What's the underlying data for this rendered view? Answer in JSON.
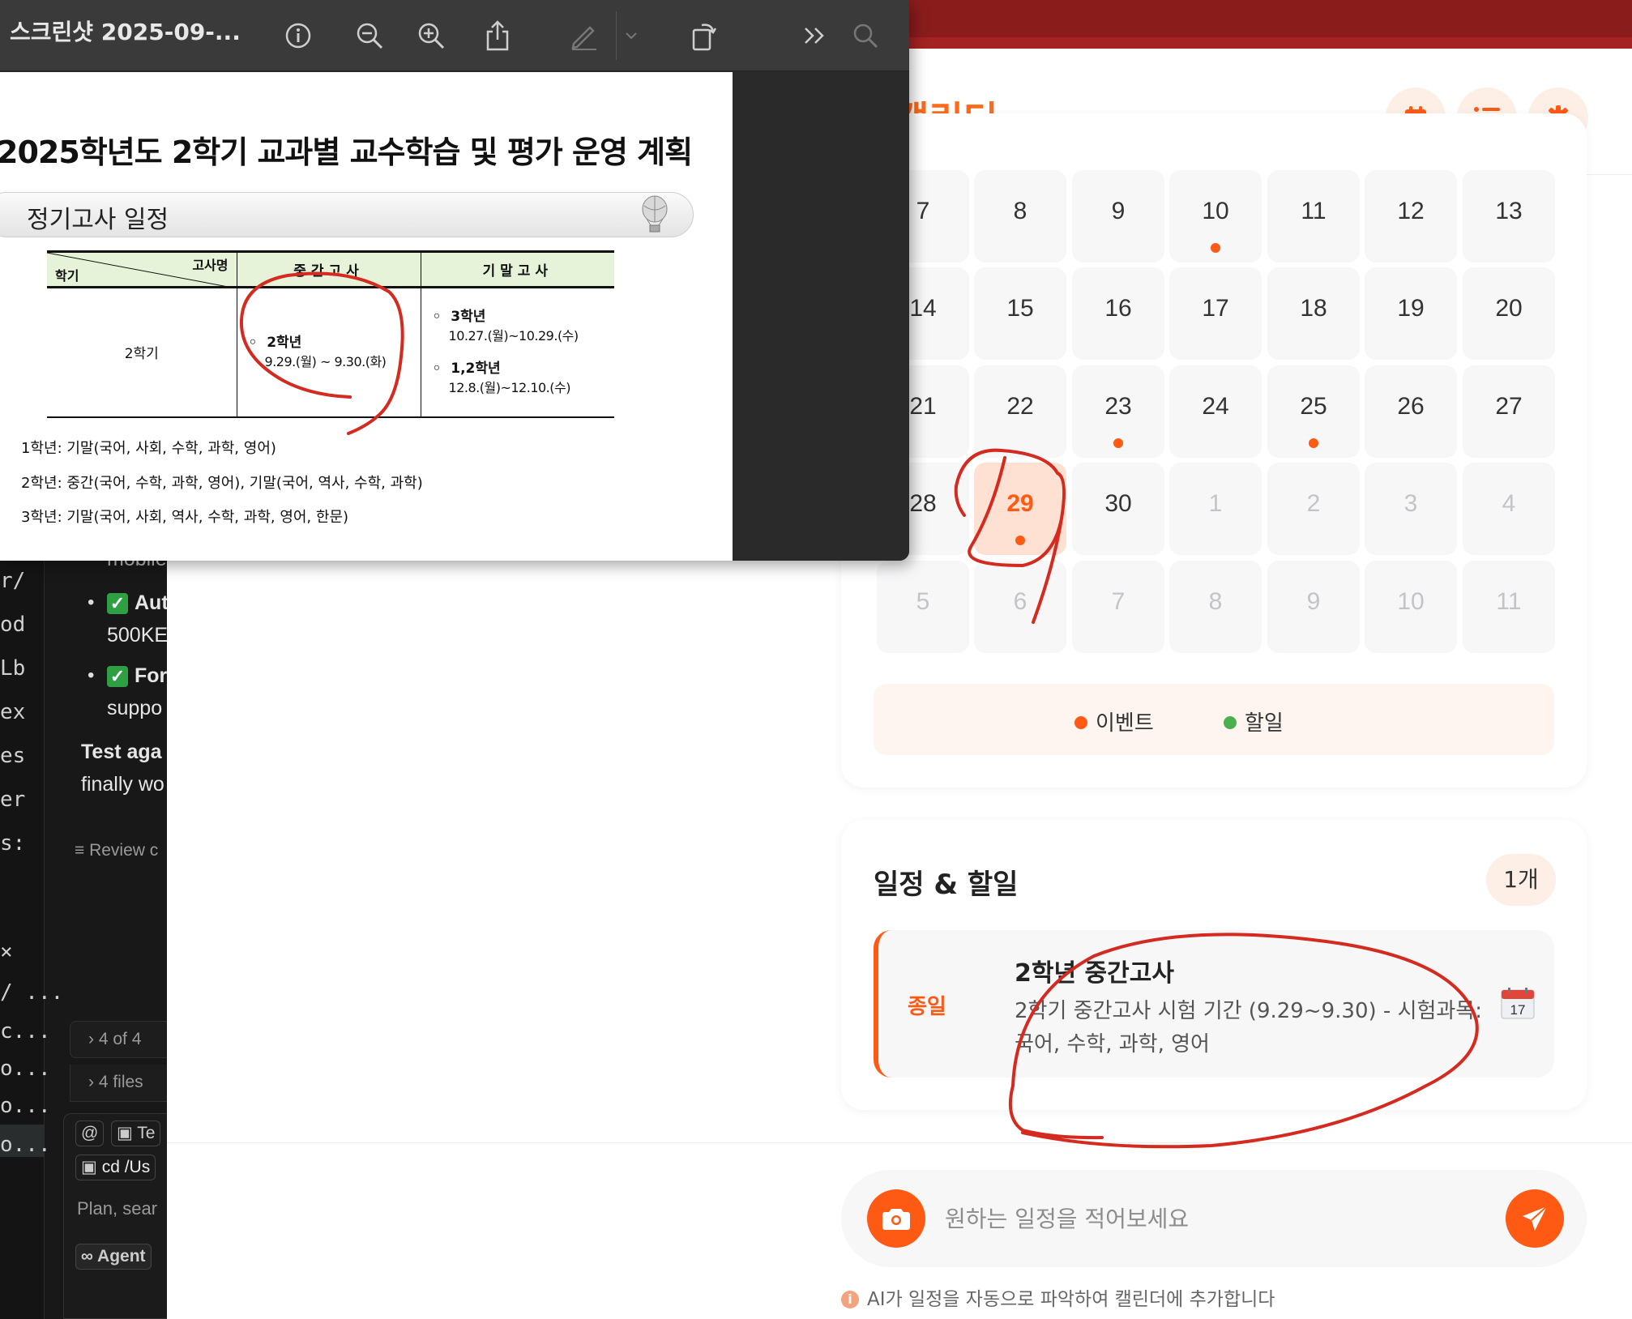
{
  "ide": {
    "edge_rows": [
      "r/",
      "od",
      "Lb",
      "ex",
      "es",
      "er",
      "s:",
      "×",
      "/ ...",
      "c...",
      "o...",
      "o...",
      "o..."
    ],
    "top_fragment": "mobile",
    "item1_title": "Aut",
    "item1_sub": "500KE",
    "item2_title": "For",
    "item2_sub": "suppo",
    "test_line1": "Test aga",
    "test_line2": "finally wo",
    "review": "≡ Review c",
    "panel1": "› 4 of 4",
    "panel2": "› 4 files",
    "chip_at": "@",
    "chip_term": "Te",
    "cmd": "cd /Us",
    "plan_placeholder": "Plan, sear",
    "agent": "∞ Agent"
  },
  "preview": {
    "title": "스크린샷 2025-09-...",
    "toolbar_icons": [
      "info-icon",
      "zoom-out-icon",
      "zoom-in-icon",
      "share-icon",
      "markup-pen-icon",
      "chevron-down-icon",
      "rotate-icon",
      "more-icon",
      "search-icon"
    ],
    "doc": {
      "title": "2025학년도 2학기 교과별 교수학습 및 평가 운영 계획",
      "section": "정기고사 일정",
      "table": {
        "corner_top": "고사명",
        "corner_bottom": "학기",
        "col_mid": "중간고사",
        "col_final": "기말고사",
        "row_label": "2학기",
        "mid": [
          {
            "grade": "2학년",
            "dates": "9.29.(월) ~ 9.30.(화)"
          }
        ],
        "final": [
          {
            "grade": "3학년",
            "dates": "10.27.(월)~10.29.(수)"
          },
          {
            "grade": "1,2학년",
            "dates": "12.8.(월)~12.10.(수)"
          }
        ]
      },
      "notes": [
        "1학년: 기말(국어, 사회, 수학, 과학, 영어)",
        "2학년: 중간(국어, 수학, 과학, 영어), 기말(국어, 역사, 수학, 과학)",
        "3학년: 기말(국어, 사회, 역사, 수학, 과학, 영어, 한문)"
      ]
    }
  },
  "app": {
    "title": "트 캘린더",
    "header_buttons": [
      "calendar-icon",
      "list-icon",
      "gear-icon"
    ],
    "calendar": {
      "weeks": [
        [
          {
            "n": "7"
          },
          {
            "n": "8"
          },
          {
            "n": "9"
          },
          {
            "n": "10",
            "dot": true
          },
          {
            "n": "11"
          },
          {
            "n": "12"
          },
          {
            "n": "13"
          }
        ],
        [
          {
            "n": "14"
          },
          {
            "n": "15"
          },
          {
            "n": "16"
          },
          {
            "n": "17"
          },
          {
            "n": "18"
          },
          {
            "n": "19"
          },
          {
            "n": "20"
          }
        ],
        [
          {
            "n": "21"
          },
          {
            "n": "22"
          },
          {
            "n": "23",
            "dot": true
          },
          {
            "n": "24"
          },
          {
            "n": "25",
            "dot": true
          },
          {
            "n": "26"
          },
          {
            "n": "27"
          }
        ],
        [
          {
            "n": "28"
          },
          {
            "n": "29",
            "today": true,
            "dot": true
          },
          {
            "n": "30"
          },
          {
            "n": "1",
            "other": true
          },
          {
            "n": "2",
            "other": true
          },
          {
            "n": "3",
            "other": true
          },
          {
            "n": "4",
            "other": true
          }
        ],
        [
          {
            "n": "5",
            "other": true
          },
          {
            "n": "6",
            "other": true
          },
          {
            "n": "7",
            "other": true
          },
          {
            "n": "8",
            "other": true
          },
          {
            "n": "9",
            "other": true
          },
          {
            "n": "10",
            "other": true
          },
          {
            "n": "11",
            "other": true
          }
        ]
      ],
      "legend": [
        {
          "label": "이벤트",
          "color": "#ff5a14"
        },
        {
          "label": "할일",
          "color": "#4caf50"
        }
      ]
    },
    "events": {
      "title": "일정 & 할일",
      "count": "1개",
      "items": [
        {
          "tag": "종일",
          "title": "2학년 중간고사",
          "desc": "2학기 중간고사 시험 기간 (9.29~9.30) - 시험과목: 국어, 수학, 과학, 영어",
          "icon": "calendar-17-icon",
          "icon_text": "17"
        }
      ]
    },
    "input": {
      "placeholder": "원하는 일정을 적어보세요"
    },
    "hint": "AI가 일정을 자동으로 파악하여 캘린더에 추가합니다",
    "colors": {
      "accent": "#ff5a14",
      "topbar": "#8b1c1c"
    }
  }
}
